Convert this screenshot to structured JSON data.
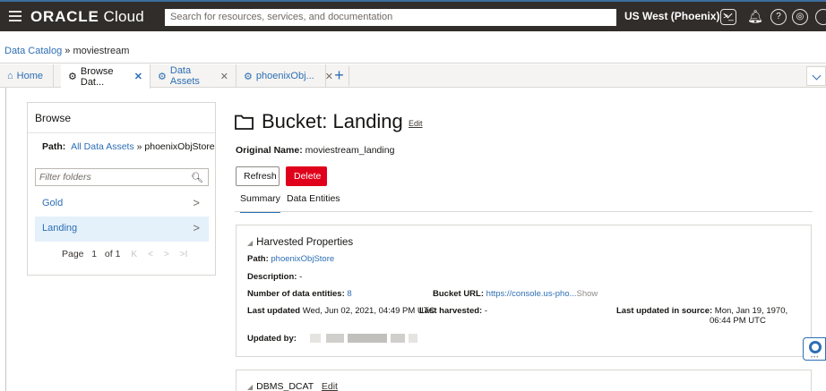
{
  "topbar": {
    "brand_bold": "ORACLE",
    "brand_light": " Cloud",
    "search_placeholder": "Search for resources, services, and documentation",
    "region": "US West (Phoenix)"
  },
  "breadcrumb": {
    "root": "Data Catalog",
    "sep": " » ",
    "current": "moviestream"
  },
  "tabs": [
    {
      "label": "Home",
      "icon": "home-icon"
    },
    {
      "label": "Browse Dat...",
      "icon": "catalog-icon",
      "close": "✕"
    },
    {
      "label": "Data Assets",
      "icon": "catalog-icon",
      "close": "✕"
    },
    {
      "label": "phoenixObj...",
      "icon": "catalog-icon",
      "close": "✕"
    }
  ],
  "browse": {
    "title": "Browse",
    "path_label": "Path:",
    "path_root": "All Data Assets",
    "path_sep": " » ",
    "path_current": "phoenixObjStore",
    "filter_placeholder": "Filter folders",
    "folders": [
      "Gold",
      "Landing"
    ],
    "pager": {
      "label": "Page",
      "page": "1",
      "of": "of 1"
    }
  },
  "main": {
    "title": "Bucket: Landing",
    "edit_label": "Edit",
    "original_name_label": "Original Name:",
    "original_name_value": "moviestream_landing",
    "refresh_label": "Refresh",
    "delete_label": "Delete",
    "subtabs": [
      "Summary",
      "Data Entities"
    ]
  },
  "harvested": {
    "title": "Harvested Properties",
    "path_label": "Path:",
    "path_value": "phoenixObjStore",
    "description_label": "Description:",
    "description_value": "-",
    "entities_label": "Number of data entities:",
    "entities_value": "8",
    "bucket_url_label": "Bucket URL:",
    "bucket_url_value": "https://console.us-pho...",
    "show_label": "Show",
    "last_updated_label": "Last updated",
    "last_updated_value": "Wed, Jun 02, 2021, 04:49 PM UTC",
    "last_harvested_label": "Last harvested:",
    "last_harvested_value": "-",
    "last_updated_source_label": "Last updated in source:",
    "last_updated_source_value_1": "Mon, Jan 19, 1970,",
    "last_updated_source_value_2": "06:44 PM UTC",
    "updated_by_label": "Updated by:"
  },
  "dbms": {
    "title": "DBMS_DCAT",
    "edit_label": "Edit"
  }
}
